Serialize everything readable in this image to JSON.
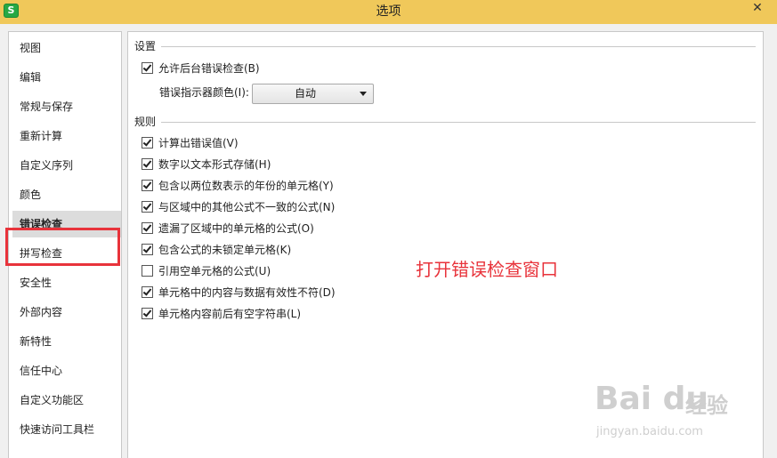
{
  "window": {
    "title": "选项",
    "app_icon_letter": "S",
    "close_glyph": "✕"
  },
  "sidebar": {
    "items": [
      {
        "label": "视图"
      },
      {
        "label": "编辑"
      },
      {
        "label": "常规与保存"
      },
      {
        "label": "重新计算"
      },
      {
        "label": "自定义序列"
      },
      {
        "label": "颜色"
      },
      {
        "label": "错误检查",
        "selected": true
      },
      {
        "label": "拼写检查"
      },
      {
        "label": "安全性"
      },
      {
        "label": "外部内容"
      },
      {
        "label": "新特性"
      },
      {
        "label": "信任中心"
      },
      {
        "label": "自定义功能区"
      },
      {
        "label": "快速访问工具栏"
      }
    ]
  },
  "settings": {
    "header": "设置",
    "background_check": {
      "label": "允许后台错误检查(B)",
      "checked": true
    },
    "indicator_color_label": "错误指示器颜色(I):",
    "indicator_color_value": "自动"
  },
  "rules": {
    "header": "规则",
    "items": [
      {
        "label": "计算出错误值(V)",
        "checked": true
      },
      {
        "label": "数字以文本形式存储(H)",
        "checked": true
      },
      {
        "label": "包含以两位数表示的年份的单元格(Y)",
        "checked": true
      },
      {
        "label": "与区域中的其他公式不一致的公式(N)",
        "checked": true
      },
      {
        "label": "遗漏了区域中的单元格的公式(O)",
        "checked": true
      },
      {
        "label": "包含公式的未锁定单元格(K)",
        "checked": true
      },
      {
        "label": "引用空单元格的公式(U)",
        "checked": false
      },
      {
        "label": "单元格中的内容与数据有效性不符(D)",
        "checked": true
      },
      {
        "label": "单元格内容前后有空字符串(L)",
        "checked": true
      }
    ]
  },
  "annotation": {
    "text": "打开错误检查窗口",
    "color": "#e8333b"
  },
  "watermark": {
    "logo": "Bai du",
    "jingyan": "经验",
    "url": "jingyan.baidu.com"
  },
  "colors": {
    "title_bar": "#f0c85a",
    "highlight": "#e8333b",
    "selected_item": "#dcdcdc"
  }
}
